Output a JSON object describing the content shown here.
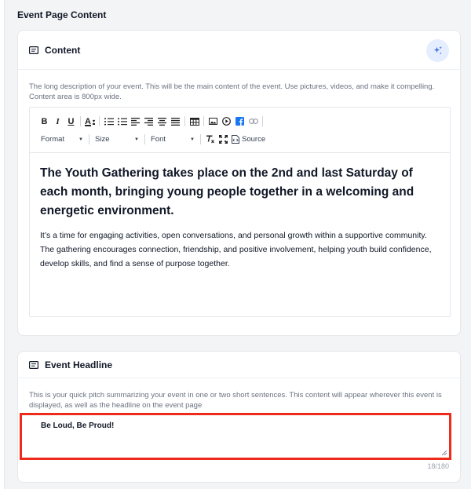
{
  "page": {
    "section_title": "Event Page Content"
  },
  "content_card": {
    "title": "Content",
    "help": "The long description of your event. This will be the main content of the event. Use pictures, videos, and make it compelling. Content area is 800px wide.",
    "toolbar": {
      "bold": "B",
      "italic": "I",
      "underline": "U",
      "text_color": "A",
      "format_label": "Format",
      "size_label": "Size",
      "font_label": "Font",
      "source_label": "Source"
    },
    "body": {
      "heading": "The Youth Gathering takes place on the 2nd and last Saturday of each month, bringing young people together in a welcoming and energetic environment.",
      "paragraph": "It’s a time for engaging activities, open conversations, and personal growth within a supportive community. The gathering encourages connection, friendship, and positive involvement, helping youth build confidence, develop skills, and find a sense of purpose together."
    }
  },
  "headline_card": {
    "title": "Event Headline",
    "help": "This is your quick pitch summarizing your event in one or two short sentences. This content will appear wherever this event is displayed, as well as the headline on the event page",
    "value": "Be Loud, Be Proud!",
    "counter": "18/180"
  },
  "colors": {
    "accent": "#3b6fe0",
    "highlight": "#ee2a1b",
    "facebook": "#1877f2"
  },
  "icons": [
    "document-icon",
    "sparkle-icon",
    "table-icon",
    "image-icon",
    "video-icon",
    "facebook-icon",
    "link-icon",
    "clear-format-icon",
    "maximize-icon",
    "source-icon"
  ]
}
